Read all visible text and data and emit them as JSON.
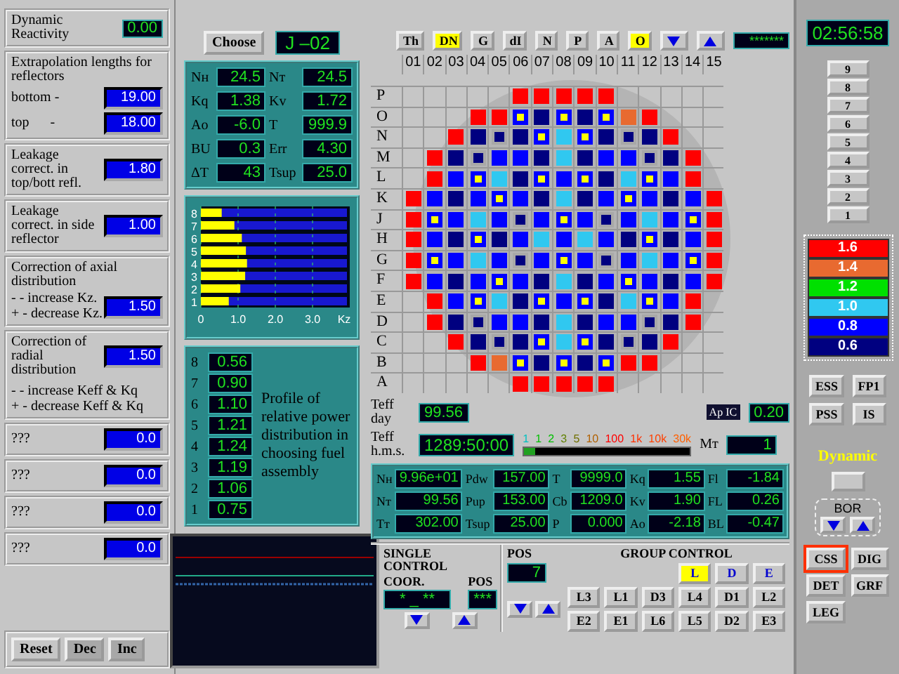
{
  "left_panel": {
    "sections": [
      {
        "kind": "display",
        "title": "Dynamic Reactivity",
        "value": "0.00"
      },
      {
        "kind": "rows",
        "title": "Extrapolation lengths for reflectors",
        "rows": [
          {
            "label": "bottom -",
            "value": "19.00"
          },
          {
            "label": "top      -",
            "value": "18.00"
          }
        ]
      },
      {
        "kind": "field",
        "title": "Leakage correct. in top/bott refl.",
        "value": "1.80"
      },
      {
        "kind": "field",
        "title": "Leakage correct. in side reflector",
        "value": "1.00"
      },
      {
        "kind": "field",
        "title": "Correction of axial distribution",
        "notes": [
          "- - increase Kz.",
          "+ - decrease Kz."
        ],
        "value": "1.50"
      },
      {
        "kind": "field_below",
        "title": "Correction of radial distribution",
        "notes": [
          "- - increase Keff & Kq",
          "+ - decrease Keff & Kq"
        ],
        "value": "1.50"
      },
      {
        "kind": "field",
        "title": "???",
        "value": "0.0"
      },
      {
        "kind": "field",
        "title": "???",
        "value": "0.0"
      },
      {
        "kind": "field",
        "title": "???",
        "value": "0.0"
      },
      {
        "kind": "field",
        "title": "???",
        "value": "0.0"
      }
    ],
    "buttons": [
      "Reset",
      "Dec",
      "Inc"
    ]
  },
  "assembly": {
    "button": "Choose",
    "value": "J –02",
    "params": [
      {
        "label": "Nн",
        "value": "24.5"
      },
      {
        "label": "Nт",
        "value": "24.5"
      },
      {
        "label": "Kq",
        "value": "1.38"
      },
      {
        "label": "Kv",
        "value": "1.72"
      },
      {
        "label": "Ao",
        "value": "-6.0"
      },
      {
        "label": "T",
        "value": "999.9"
      },
      {
        "label": "BU",
        "value": "0.3"
      },
      {
        "label": "Err",
        "value": "4.30"
      },
      {
        "label": "ΔT",
        "value": "43"
      },
      {
        "label": "Tsup",
        "value": "25.0"
      }
    ],
    "chart_data": {
      "type": "bar",
      "orientation": "horizontal",
      "categories": [
        "8",
        "7",
        "6",
        "5",
        "4",
        "3",
        "2",
        "1"
      ],
      "values": [
        0.56,
        0.9,
        1.1,
        1.21,
        1.24,
        1.19,
        1.06,
        0.75
      ],
      "xlim": [
        0,
        4
      ],
      "xticks": [
        0,
        {
          "value": 1,
          "label": "1.0"
        },
        {
          "value": 2,
          "label": "2.0"
        },
        {
          "value": 3,
          "label": "3.0"
        }
      ],
      "xlabel": "Kz",
      "grid": true
    },
    "profile": [
      {
        "layer": "8",
        "value": "0.56"
      },
      {
        "layer": "7",
        "value": "0.90"
      },
      {
        "layer": "6",
        "value": "1.10"
      },
      {
        "layer": "5",
        "value": "1.21"
      },
      {
        "layer": "4",
        "value": "1.24"
      },
      {
        "layer": "3",
        "value": "1.19"
      },
      {
        "layer": "2",
        "value": "1.06"
      },
      {
        "layer": "1",
        "value": "0.75"
      }
    ],
    "caption": "Profile of relative power distribution in choosing fuel assembly"
  },
  "toolbar": {
    "items": [
      {
        "kind": "text",
        "label": "Th",
        "selected": false
      },
      {
        "kind": "text",
        "label": "DN",
        "selected": true
      },
      {
        "kind": "text",
        "label": "G",
        "selected": false
      },
      {
        "kind": "text",
        "label": "dI",
        "selected": false
      },
      {
        "kind": "text",
        "label": "N",
        "selected": false
      },
      {
        "kind": "text",
        "label": "P",
        "selected": false
      },
      {
        "kind": "text",
        "label": "A",
        "selected": false
      },
      {
        "kind": "text",
        "label": "O",
        "selected": true
      },
      {
        "kind": "down",
        "selected": false
      },
      {
        "kind": "up",
        "selected": false
      }
    ],
    "display": "*******"
  },
  "core": {
    "columns": [
      "01",
      "02",
      "03",
      "04",
      "05",
      "06",
      "07",
      "08",
      "09",
      "10",
      "11",
      "12",
      "13",
      "14",
      "15"
    ],
    "rows": [
      {
        "label": "P",
        "cells": [
          null,
          null,
          null,
          null,
          null,
          {
            "color": "#ff0000",
            "kind": "plain"
          },
          {
            "color": "#ff0000",
            "kind": "plain"
          },
          {
            "color": "#ff0000",
            "kind": "plain"
          },
          {
            "color": "#ff0000",
            "kind": "plain"
          },
          {
            "color": "#ff0000",
            "kind": "plain"
          },
          null,
          null,
          null,
          null,
          null
        ]
      },
      {
        "label": "O",
        "cells": [
          null,
          null,
          null,
          {
            "color": "#ff0000",
            "kind": "plain"
          },
          {
            "color": "#ff0000",
            "kind": "plain"
          },
          {
            "color": "#0000ff",
            "kind": "rod"
          },
          {
            "color": "#000080",
            "kind": "plain"
          },
          {
            "color": "#0000ff",
            "kind": "rod"
          },
          {
            "color": "#000080",
            "kind": "plain"
          },
          {
            "color": "#0000ff",
            "kind": "rod"
          },
          {
            "color": "#e86a30",
            "kind": "plain"
          },
          {
            "color": "#ff0000",
            "kind": "plain"
          },
          null,
          null,
          null
        ]
      },
      {
        "label": "N",
        "cells": [
          null,
          null,
          {
            "color": "#ff0000",
            "kind": "plain"
          },
          {
            "color": "#000080",
            "kind": "plain"
          },
          {
            "color": "#000080",
            "kind": "ring"
          },
          {
            "color": "#000080",
            "kind": "plain"
          },
          {
            "color": "#0000ff",
            "kind": "rod"
          },
          {
            "color": "#30c8f0",
            "kind": "plain"
          },
          {
            "color": "#0000ff",
            "kind": "rod"
          },
          {
            "color": "#000080",
            "kind": "plain"
          },
          {
            "color": "#000080",
            "kind": "ring"
          },
          {
            "color": "#000080",
            "kind": "plain"
          },
          {
            "color": "#ff0000",
            "kind": "plain"
          },
          null,
          null
        ]
      },
      {
        "label": "M",
        "cells": [
          null,
          {
            "color": "#ff0000",
            "kind": "plain"
          },
          {
            "color": "#000080",
            "kind": "plain"
          },
          {
            "color": "#000080",
            "kind": "ring"
          },
          {
            "color": "#0000ff",
            "kind": "plain"
          },
          {
            "color": "#0000ff",
            "kind": "plain"
          },
          {
            "color": "#000080",
            "kind": "plain"
          },
          {
            "color": "#30c8f0",
            "kind": "plain"
          },
          {
            "color": "#000080",
            "kind": "plain"
          },
          {
            "color": "#0000ff",
            "kind": "plain"
          },
          {
            "color": "#0000ff",
            "kind": "plain"
          },
          {
            "color": "#000080",
            "kind": "ring"
          },
          {
            "color": "#000080",
            "kind": "plain"
          },
          {
            "color": "#ff0000",
            "kind": "plain"
          },
          null
        ]
      },
      {
        "label": "L",
        "cells": [
          null,
          {
            "color": "#ff0000",
            "kind": "plain"
          },
          {
            "color": "#0000ff",
            "kind": "plain"
          },
          {
            "color": "#0000ff",
            "kind": "rod"
          },
          {
            "color": "#30c8f0",
            "kind": "plain"
          },
          {
            "color": "#000080",
            "kind": "plain"
          },
          {
            "color": "#0000ff",
            "kind": "rod"
          },
          {
            "color": "#0000ff",
            "kind": "plain"
          },
          {
            "color": "#0000ff",
            "kind": "rod"
          },
          {
            "color": "#000080",
            "kind": "plain"
          },
          {
            "color": "#30c8f0",
            "kind": "plain"
          },
          {
            "color": "#0000ff",
            "kind": "rod"
          },
          {
            "color": "#0000ff",
            "kind": "plain"
          },
          {
            "color": "#ff0000",
            "kind": "plain"
          },
          null
        ]
      },
      {
        "label": "K",
        "cells": [
          {
            "color": "#ff0000",
            "kind": "plain"
          },
          {
            "color": "#0000ff",
            "kind": "plain"
          },
          {
            "color": "#000080",
            "kind": "plain"
          },
          {
            "color": "#0000ff",
            "kind": "plain"
          },
          {
            "color": "#0000ff",
            "kind": "rod"
          },
          {
            "color": "#0000ff",
            "kind": "plain"
          },
          {
            "color": "#000080",
            "kind": "plain"
          },
          {
            "color": "#30c8f0",
            "kind": "plain"
          },
          {
            "color": "#000080",
            "kind": "plain"
          },
          {
            "color": "#0000ff",
            "kind": "plain"
          },
          {
            "color": "#0000ff",
            "kind": "rod"
          },
          {
            "color": "#0000ff",
            "kind": "plain"
          },
          {
            "color": "#000080",
            "kind": "plain"
          },
          {
            "color": "#0000ff",
            "kind": "plain"
          },
          {
            "color": "#ff0000",
            "kind": "plain"
          }
        ]
      },
      {
        "label": "J",
        "cells": [
          {
            "color": "#ff0000",
            "kind": "plain"
          },
          {
            "color": "#0000ff",
            "kind": "rod"
          },
          {
            "color": "#0000ff",
            "kind": "plain"
          },
          {
            "color": "#30c8f0",
            "kind": "plain"
          },
          {
            "color": "#0000ff",
            "kind": "plain"
          },
          {
            "color": "#000080",
            "kind": "ring"
          },
          {
            "color": "#0000ff",
            "kind": "plain"
          },
          {
            "color": "#0000ff",
            "kind": "rod"
          },
          {
            "color": "#0000ff",
            "kind": "plain"
          },
          {
            "color": "#000080",
            "kind": "ring"
          },
          {
            "color": "#0000ff",
            "kind": "plain"
          },
          {
            "color": "#30c8f0",
            "kind": "plain"
          },
          {
            "color": "#0000ff",
            "kind": "plain"
          },
          {
            "color": "#0000ff",
            "kind": "rod"
          },
          {
            "color": "#ff0000",
            "kind": "plain"
          }
        ]
      },
      {
        "label": "H",
        "cells": [
          {
            "color": "#ff0000",
            "kind": "plain"
          },
          {
            "color": "#0000ff",
            "kind": "plain"
          },
          {
            "color": "#000080",
            "kind": "plain"
          },
          {
            "color": "#0000ff",
            "kind": "rod"
          },
          {
            "color": "#000080",
            "kind": "plain"
          },
          {
            "color": "#0000ff",
            "kind": "plain"
          },
          {
            "color": "#30c8f0",
            "kind": "plain"
          },
          {
            "color": "#0000ff",
            "kind": "plain"
          },
          {
            "color": "#30c8f0",
            "kind": "plain"
          },
          {
            "color": "#0000ff",
            "kind": "plain"
          },
          {
            "color": "#000080",
            "kind": "plain"
          },
          {
            "color": "#0000ff",
            "kind": "rod"
          },
          {
            "color": "#000080",
            "kind": "plain"
          },
          {
            "color": "#0000ff",
            "kind": "plain"
          },
          {
            "color": "#ff0000",
            "kind": "plain"
          }
        ]
      },
      {
        "label": "G",
        "cells": [
          {
            "color": "#ff0000",
            "kind": "plain"
          },
          {
            "color": "#0000ff",
            "kind": "rod"
          },
          {
            "color": "#0000ff",
            "kind": "plain"
          },
          {
            "color": "#30c8f0",
            "kind": "plain"
          },
          {
            "color": "#0000ff",
            "kind": "plain"
          },
          {
            "color": "#000080",
            "kind": "ring"
          },
          {
            "color": "#0000ff",
            "kind": "plain"
          },
          {
            "color": "#0000ff",
            "kind": "rod"
          },
          {
            "color": "#0000ff",
            "kind": "plain"
          },
          {
            "color": "#000080",
            "kind": "ring"
          },
          {
            "color": "#0000ff",
            "kind": "plain"
          },
          {
            "color": "#30c8f0",
            "kind": "plain"
          },
          {
            "color": "#0000ff",
            "kind": "plain"
          },
          {
            "color": "#0000ff",
            "kind": "rod"
          },
          {
            "color": "#ff0000",
            "kind": "plain"
          }
        ]
      },
      {
        "label": "F",
        "cells": [
          {
            "color": "#ff0000",
            "kind": "plain"
          },
          {
            "color": "#0000ff",
            "kind": "plain"
          },
          {
            "color": "#000080",
            "kind": "plain"
          },
          {
            "color": "#0000ff",
            "kind": "plain"
          },
          {
            "color": "#0000ff",
            "kind": "rod"
          },
          {
            "color": "#0000ff",
            "kind": "plain"
          },
          {
            "color": "#000080",
            "kind": "plain"
          },
          {
            "color": "#30c8f0",
            "kind": "plain"
          },
          {
            "color": "#000080",
            "kind": "plain"
          },
          {
            "color": "#0000ff",
            "kind": "plain"
          },
          {
            "color": "#0000ff",
            "kind": "rod"
          },
          {
            "color": "#0000ff",
            "kind": "plain"
          },
          {
            "color": "#000080",
            "kind": "plain"
          },
          {
            "color": "#0000ff",
            "kind": "plain"
          },
          {
            "color": "#ff0000",
            "kind": "plain"
          }
        ]
      },
      {
        "label": "E",
        "cells": [
          null,
          {
            "color": "#ff0000",
            "kind": "plain"
          },
          {
            "color": "#0000ff",
            "kind": "plain"
          },
          {
            "color": "#0000ff",
            "kind": "rod"
          },
          {
            "color": "#30c8f0",
            "kind": "plain"
          },
          {
            "color": "#000080",
            "kind": "plain"
          },
          {
            "color": "#0000ff",
            "kind": "rod"
          },
          {
            "color": "#0000ff",
            "kind": "plain"
          },
          {
            "color": "#0000ff",
            "kind": "rod"
          },
          {
            "color": "#000080",
            "kind": "plain"
          },
          {
            "color": "#30c8f0",
            "kind": "plain"
          },
          {
            "color": "#0000ff",
            "kind": "rod"
          },
          {
            "color": "#0000ff",
            "kind": "plain"
          },
          {
            "color": "#ff0000",
            "kind": "plain"
          },
          null
        ]
      },
      {
        "label": "D",
        "cells": [
          null,
          {
            "color": "#ff0000",
            "kind": "plain"
          },
          {
            "color": "#000080",
            "kind": "plain"
          },
          {
            "color": "#000080",
            "kind": "ring"
          },
          {
            "color": "#0000ff",
            "kind": "plain"
          },
          {
            "color": "#0000ff",
            "kind": "plain"
          },
          {
            "color": "#000080",
            "kind": "plain"
          },
          {
            "color": "#30c8f0",
            "kind": "plain"
          },
          {
            "color": "#000080",
            "kind": "plain"
          },
          {
            "color": "#0000ff",
            "kind": "plain"
          },
          {
            "color": "#0000ff",
            "kind": "plain"
          },
          {
            "color": "#000080",
            "kind": "ring"
          },
          {
            "color": "#000080",
            "kind": "plain"
          },
          {
            "color": "#ff0000",
            "kind": "plain"
          },
          null
        ]
      },
      {
        "label": "C",
        "cells": [
          null,
          null,
          {
            "color": "#ff0000",
            "kind": "plain"
          },
          {
            "color": "#000080",
            "kind": "plain"
          },
          {
            "color": "#000080",
            "kind": "ring"
          },
          {
            "color": "#000080",
            "kind": "plain"
          },
          {
            "color": "#0000ff",
            "kind": "rod"
          },
          {
            "color": "#30c8f0",
            "kind": "plain"
          },
          {
            "color": "#0000ff",
            "kind": "rod"
          },
          {
            "color": "#000080",
            "kind": "plain"
          },
          {
            "color": "#000080",
            "kind": "ring"
          },
          {
            "color": "#000080",
            "kind": "plain"
          },
          {
            "color": "#ff0000",
            "kind": "plain"
          },
          null,
          null
        ]
      },
      {
        "label": "B",
        "cells": [
          null,
          null,
          null,
          {
            "color": "#ff0000",
            "kind": "plain"
          },
          {
            "color": "#e86a30",
            "kind": "plain"
          },
          {
            "color": "#0000ff",
            "kind": "rod"
          },
          {
            "color": "#000080",
            "kind": "plain"
          },
          {
            "color": "#0000ff",
            "kind": "rod"
          },
          {
            "color": "#000080",
            "kind": "plain"
          },
          {
            "color": "#0000ff",
            "kind": "rod"
          },
          {
            "color": "#ff0000",
            "kind": "plain"
          },
          {
            "color": "#ff0000",
            "kind": "plain"
          },
          null,
          null,
          null
        ]
      },
      {
        "label": "A",
        "cells": [
          null,
          null,
          null,
          null,
          null,
          {
            "color": "#ff0000",
            "kind": "plain"
          },
          {
            "color": "#ff0000",
            "kind": "plain"
          },
          {
            "color": "#ff0000",
            "kind": "plain"
          },
          {
            "color": "#ff0000",
            "kind": "plain"
          },
          {
            "color": "#ff0000",
            "kind": "plain"
          },
          null,
          null,
          null,
          null,
          null
        ]
      }
    ]
  },
  "teff": {
    "day_label": "Teff day",
    "day_value": "99.56",
    "hms_label": "Teff h.m.s.",
    "hms_value": "1289:50:00",
    "ap_label": "Ap IC",
    "ap_value": "0.20",
    "m_label": "Mт",
    "m_value": "1",
    "scale": [
      {
        "label": "1",
        "color": "#00c0c0"
      },
      {
        "label": "1",
        "color": "#00c000"
      },
      {
        "label": "2",
        "color": "#00c000"
      },
      {
        "label": "3",
        "color": "#608000"
      },
      {
        "label": "5",
        "color": "#707000"
      },
      {
        "label": "10",
        "color": "#b06000"
      },
      {
        "label": "100",
        "color": "#ff0000"
      },
      {
        "label": "1k",
        "color": "#ff3000"
      },
      {
        "label": "10k",
        "color": "#ff4000"
      },
      {
        "label": "30k",
        "color": "#ff6000"
      }
    ],
    "level": 0.07
  },
  "plant_params": [
    {
      "label": "Nн",
      "value": "9.96e+01"
    },
    {
      "label": "Pdw",
      "value": "157.00"
    },
    {
      "label": "T",
      "value": "9999.0"
    },
    {
      "label": "Kq",
      "value": "1.55"
    },
    {
      "label": "Fl",
      "value": "-1.84"
    },
    {
      "label": "Nт",
      "value": "99.56"
    },
    {
      "label": "Pup",
      "value": "153.00"
    },
    {
      "label": "Cb",
      "value": "1209.0"
    },
    {
      "label": "Kv",
      "value": "1.90"
    },
    {
      "label": "FL",
      "value": "0.26"
    },
    {
      "label": "Tт",
      "value": "302.00"
    },
    {
      "label": "Tsup",
      "value": "25.00"
    },
    {
      "label": "P",
      "value": "0.000"
    },
    {
      "label": "Ao",
      "value": "-2.18"
    },
    {
      "label": "BL",
      "value": "-0.47"
    }
  ],
  "single_control": {
    "title": "SINGLE CONTROL",
    "coor_label": "COOR.",
    "coor_value": "* _ **",
    "pos_label": "POS",
    "pos_value": "***"
  },
  "group_control": {
    "title": "GROUP CONTROL",
    "pos_label": "POS",
    "pos_value": "7",
    "groups": [
      {
        "label": "L",
        "selected": true
      },
      {
        "label": "D",
        "selected": false
      },
      {
        "label": "E",
        "selected": false
      }
    ],
    "rods": [
      "L3",
      "L1",
      "D3",
      "L4",
      "D1",
      "L2",
      "E2",
      "E1",
      "L6",
      "L5",
      "D2",
      "E3"
    ]
  },
  "right_panel": {
    "clock": "02:56:58",
    "layers": [
      "9",
      "8",
      "7",
      "6",
      "5",
      "4",
      "3",
      "2",
      "1"
    ],
    "legend": [
      {
        "label": "1.6",
        "color": "#ff0000"
      },
      {
        "label": "1.4",
        "color": "#e86a30"
      },
      {
        "label": "1.2",
        "color": "#00e000"
      },
      {
        "label": "1.0",
        "color": "#30c8f0"
      },
      {
        "label": "0.8",
        "color": "#0000ff"
      },
      {
        "label": "0.6",
        "color": "#000080"
      }
    ],
    "protections": [
      "ESS",
      "FP1",
      "PSS",
      "IS"
    ],
    "mode_label": "Dynamic",
    "bor_label": "BOR",
    "views": [
      {
        "label": "CSS",
        "selected": true
      },
      {
        "label": "DIG",
        "selected": false
      },
      {
        "label": "DET",
        "selected": false
      },
      {
        "label": "GRF",
        "selected": false
      },
      {
        "label": "LEG",
        "selected": false
      }
    ]
  }
}
